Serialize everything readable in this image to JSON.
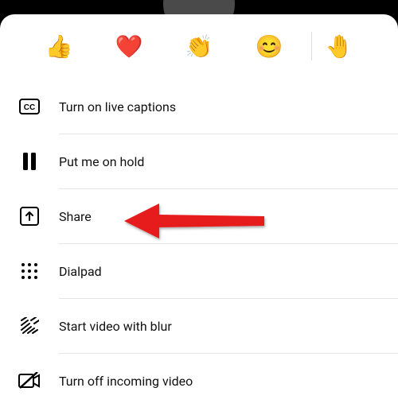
{
  "reactions": {
    "thumbs": "👍",
    "heart": "❤️",
    "clap": "👏",
    "smile": "😊",
    "raise_hand": "🤚"
  },
  "menu": {
    "captions": {
      "label": "Turn on live captions"
    },
    "hold": {
      "label": "Put me on hold"
    },
    "share": {
      "label": "Share"
    },
    "dialpad": {
      "label": "Dialpad"
    },
    "blur": {
      "label": "Start video with blur"
    },
    "incoming_off": {
      "label": "Turn off incoming video"
    }
  },
  "annotation": {
    "arrow_color": "#e61e1e"
  }
}
